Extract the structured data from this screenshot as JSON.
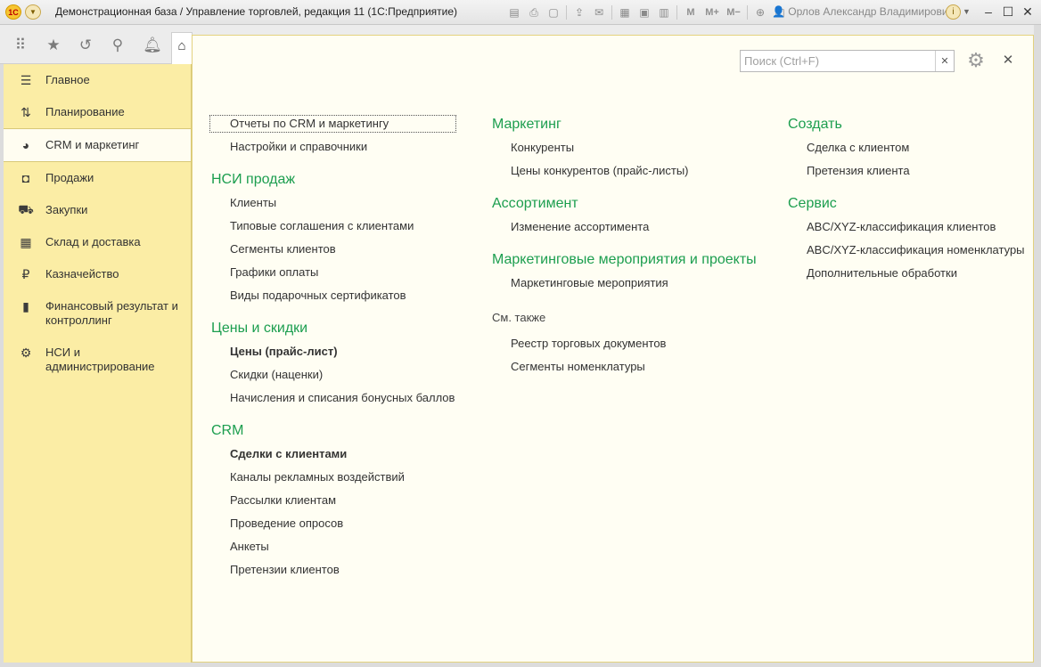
{
  "window": {
    "title": "Демонстрационная база / Управление торговлей, редакция 11  (1С:Предприятие)",
    "logo_text": "1С",
    "user": "Орлов Александр Владимирович",
    "toolbar_text_buttons": [
      "M",
      "M+",
      "M−"
    ]
  },
  "sidebar": {
    "items": [
      {
        "label": "Главное",
        "icon": "menu-icon"
      },
      {
        "label": "Планирование",
        "icon": "planning-icon"
      },
      {
        "label": "CRM и маркетинг",
        "icon": "pie-chart-icon"
      },
      {
        "label": "Продажи",
        "icon": "shopping-bag-icon"
      },
      {
        "label": "Закупки",
        "icon": "cart-icon"
      },
      {
        "label": "Склад и доставка",
        "icon": "warehouse-icon"
      },
      {
        "label": "Казначейство",
        "icon": "ruble-icon"
      },
      {
        "label": "Финансовый результат и контроллинг",
        "icon": "bar-chart-icon"
      },
      {
        "label": "НСИ и администрирование",
        "icon": "gear-icon"
      }
    ],
    "active_index": 2
  },
  "search": {
    "placeholder": "Поиск (Ctrl+F)",
    "value": ""
  },
  "content": {
    "col1": {
      "top_links": [
        "Отчеты по CRM и маркетингу",
        "Настройки и справочники"
      ],
      "groups": [
        {
          "title": "НСИ продаж",
          "links": [
            "Клиенты",
            "Типовые соглашения с клиентами",
            "Сегменты клиентов",
            "Графики оплаты",
            "Виды подарочных сертификатов"
          ]
        },
        {
          "title": "Цены и скидки",
          "links": [
            "Цены (прайс-лист)",
            "Скидки (наценки)",
            "Начисления и списания бонусных баллов"
          ],
          "bold": [
            0
          ]
        },
        {
          "title": "CRM",
          "links": [
            "Сделки с клиентами",
            "Каналы рекламных воздействий",
            "Рассылки клиентам",
            "Проведение опросов",
            "Анкеты",
            "Претензии клиентов"
          ],
          "bold": [
            0
          ]
        }
      ]
    },
    "col2": {
      "groups": [
        {
          "title": "Маркетинг",
          "links": [
            "Конкуренты",
            "Цены конкурентов (прайс-листы)"
          ]
        },
        {
          "title": "Ассортимент",
          "links": [
            "Изменение ассортимента"
          ]
        },
        {
          "title": "Маркетинговые мероприятия и проекты",
          "links": [
            "Маркетинговые мероприятия"
          ]
        }
      ],
      "see_also": {
        "title": "См. также",
        "links": [
          "Реестр торговых документов",
          "Сегменты номенклатуры"
        ]
      }
    },
    "col3": {
      "groups": [
        {
          "title": "Создать",
          "links": [
            "Сделка с клиентом",
            "Претензия клиента"
          ]
        },
        {
          "title": "Сервис",
          "links": [
            "ABC/XYZ-классификация клиентов",
            "ABC/XYZ-классификация номенклатуры",
            "Дополнительные обработки"
          ]
        }
      ]
    }
  },
  "colors": {
    "accent_green": "#1c9e4f",
    "sidebar_bg": "#fbeda5",
    "content_bg": "#fffef3"
  }
}
